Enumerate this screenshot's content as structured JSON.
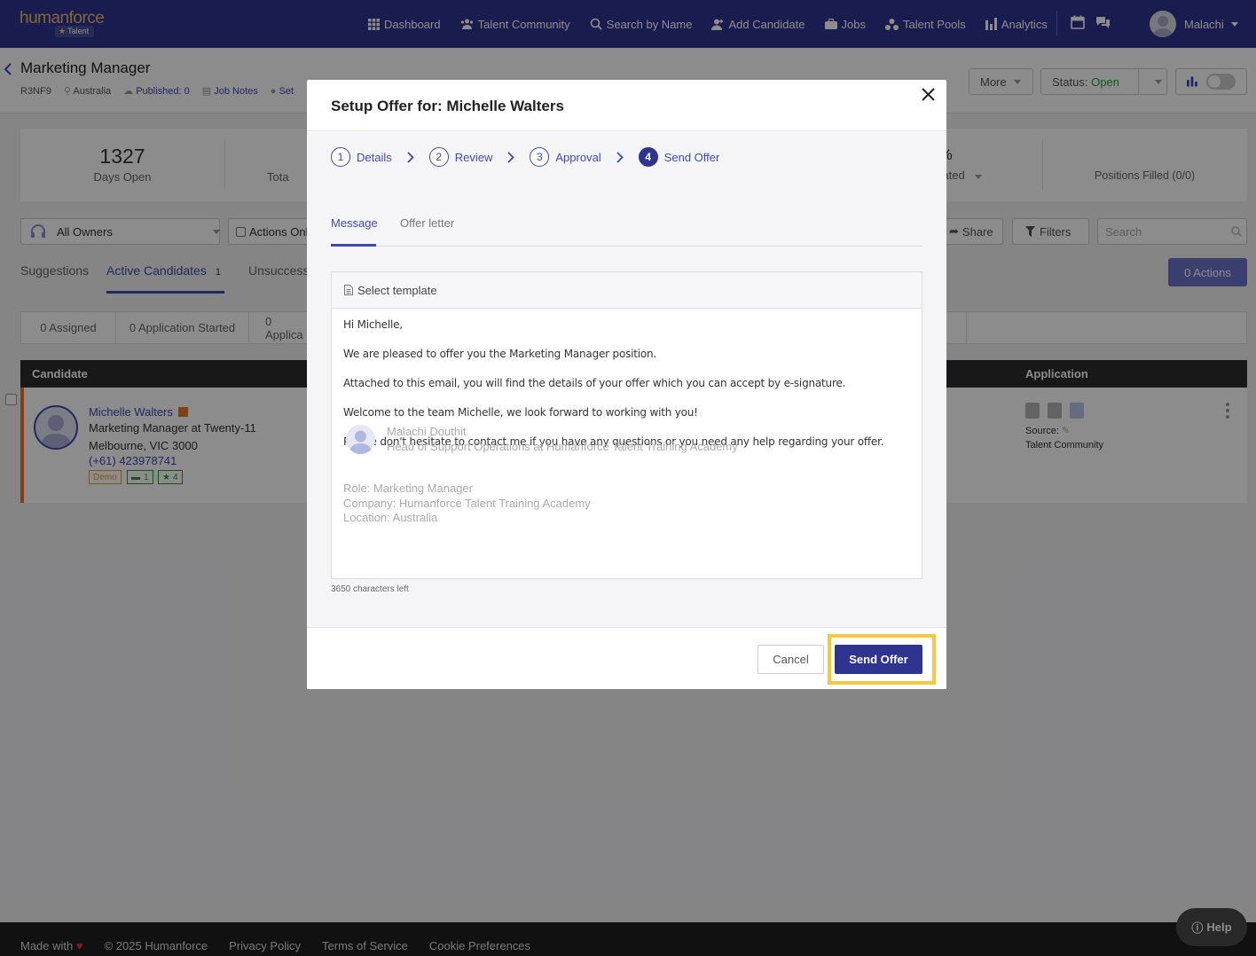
{
  "brand": {
    "logo_text": "humanforce",
    "badge": "Talent"
  },
  "nav": {
    "items": [
      {
        "label": "Dashboard",
        "icon": "grid-icon"
      },
      {
        "label": "Talent Community",
        "icon": "community-icon"
      },
      {
        "label": "Search by Name",
        "icon": "person-search-icon"
      },
      {
        "label": "Add Candidate",
        "icon": "add-person-icon"
      },
      {
        "label": "Jobs",
        "icon": "briefcase-icon"
      },
      {
        "label": "Talent Pools",
        "icon": "pools-icon"
      },
      {
        "label": "Analytics",
        "icon": "bar-chart-icon"
      }
    ],
    "user_name": "Malachi"
  },
  "job": {
    "title": "Marketing Manager",
    "code": "R3NF9",
    "location": "Australia",
    "published": "Published: 0",
    "notes": "Job Notes",
    "settings_partial": "Set"
  },
  "header_buttons": {
    "more": "More",
    "status_label": "Status:",
    "status_value": "Open"
  },
  "stats": {
    "days_open_value": "1327",
    "days_open_label": "Days Open",
    "total_partial": "Tota",
    "rated_value": ")%",
    "rated_label": "Rated",
    "positions_filled": "Positions Filled (0/0)"
  },
  "filters": {
    "owners": "All Owners",
    "actions_only": "Actions Onl",
    "share": "Share",
    "filters": "Filters",
    "search_placeholder": "Search"
  },
  "tabs": {
    "suggestions": "Suggestions",
    "active": "Active Candidates",
    "active_count": "1",
    "unsuccessful_partial": "Unsuccessf",
    "actions_button": "0 Actions"
  },
  "strip": {
    "assigned": "0 Assigned",
    "started": "0 Application Started",
    "applic_partial": "0 Applica"
  },
  "table": {
    "col_candidate": "Candidate",
    "col_application": "Application",
    "row": {
      "name": "Michelle Walters",
      "position": "Marketing Manager at Twenty-11",
      "location": "Melbourne, VIC 3000",
      "phone": "(+61) 423978741",
      "tag_demo": "Demo",
      "tag_jobs": "1",
      "tag_stars": "4",
      "source_label": "Source:",
      "source_value": "Talent Community"
    }
  },
  "footer": {
    "made_with": "Made with",
    "copyright": "© 2025 Humanforce",
    "privacy": "Privacy Policy",
    "terms": "Terms of Service",
    "cookies": "Cookie Preferences",
    "help": "Help"
  },
  "modal": {
    "title": "Setup Offer for: Michelle Walters",
    "steps": [
      {
        "num": "1",
        "label": "Details"
      },
      {
        "num": "2",
        "label": "Review"
      },
      {
        "num": "3",
        "label": "Approval"
      },
      {
        "num": "4",
        "label": "Send Offer"
      }
    ],
    "active_step": "4",
    "tab_message": "Message",
    "tab_offer_letter": "Offer letter",
    "select_template": "Select template",
    "message_lines": [
      "Hi Michelle,",
      "We are pleased to offer you the Marketing Manager position.",
      "Attached to this email, you will find the details of your offer which you can accept by e-signature.",
      "Welcome to the team Michelle, we look forward to working with you!",
      "Please don't hesitate to contact me if you have any questions or you need any help regarding your offer."
    ],
    "signature_name": "Malachi Douthit",
    "signature_role": "Head of Support Operations at Humanforce Talent Training Academy",
    "role_line": "Role: Marketing Manager",
    "company_line": "Company: Humanforce Talent Training Academy",
    "location_line": "Location: Australia",
    "chars_left": "3650 characters left",
    "cancel": "Cancel",
    "send": "Send Offer"
  },
  "colors": {
    "nav_bg": "#2e3490",
    "accent": "#3b4ab3",
    "highlight": "#f5c842",
    "status_open": "#2e9a3a",
    "row_accent": "#e8742a"
  }
}
